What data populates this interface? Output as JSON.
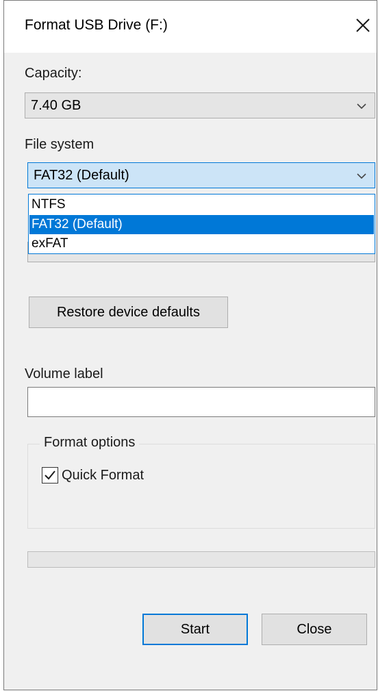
{
  "window": {
    "title": "Format USB Drive (F:)",
    "close_glyph": "✕"
  },
  "capacity": {
    "label": "Capacity:",
    "value": "7.40 GB"
  },
  "file_system": {
    "label": "File system",
    "selected": "FAT32 (Default)",
    "options": [
      "NTFS",
      "FAT32 (Default)",
      "exFAT"
    ],
    "highlighted_index": 1
  },
  "restore_button": {
    "label": "Restore device defaults"
  },
  "volume_label": {
    "label": "Volume label",
    "value": ""
  },
  "format_options": {
    "legend": "Format options",
    "quick_format_label": "Quick Format",
    "quick_format_checked": true
  },
  "progress": {
    "fraction": 0
  },
  "buttons": {
    "start": "Start",
    "close": "Close"
  },
  "colors": {
    "accent": "#0078d7",
    "dialog_bg": "#f0f0f0",
    "highlight_bg": "#cce4f7"
  },
  "icons": {
    "close": "close-icon",
    "chevron": "chevron-down-icon",
    "check": "checkmark-icon"
  }
}
